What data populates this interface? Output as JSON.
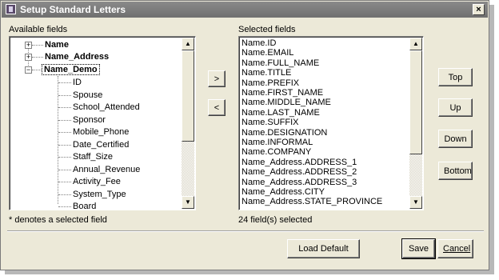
{
  "window": {
    "title": "Setup Standard Letters",
    "close_glyph": "×"
  },
  "available": {
    "label": "Available fields",
    "groups": [
      {
        "name": "Name",
        "expander": "+"
      },
      {
        "name": "Name_Address",
        "expander": "+"
      },
      {
        "name": "Name_Demo",
        "expander": "−"
      }
    ],
    "children": [
      "ID",
      "Spouse",
      "School_Attended",
      "Sponsor",
      "Mobile_Phone",
      "Date_Certified",
      "Staff_Size",
      "Annual_Revenue",
      "Activity_Fee",
      "System_Type",
      "Board"
    ],
    "note": "* denotes a selected field"
  },
  "selected": {
    "label": "Selected fields",
    "items": [
      "Name.ID",
      "Name.EMAIL",
      "Name.FULL_NAME",
      "Name.TITLE",
      "Name.PREFIX",
      "Name.FIRST_NAME",
      "Name.MIDDLE_NAME",
      "Name.LAST_NAME",
      "Name.SUFFIX",
      "Name.DESIGNATION",
      "Name.INFORMAL",
      "Name.COMPANY",
      "Name_Address.ADDRESS_1",
      "Name_Address.ADDRESS_2",
      "Name_Address.ADDRESS_3",
      "Name_Address.CITY",
      "Name_Address.STATE_PROVINCE"
    ],
    "count_text": "24 field(s) selected"
  },
  "move": {
    "add": ">",
    "remove": "<"
  },
  "order": {
    "top": "Top",
    "up": "Up",
    "down": "Down",
    "bottom": "Bottom"
  },
  "footer": {
    "load_default": "Load Default",
    "save": "Save",
    "cancel": "Cancel"
  },
  "scroll": {
    "up": "▲",
    "down": "▼"
  }
}
